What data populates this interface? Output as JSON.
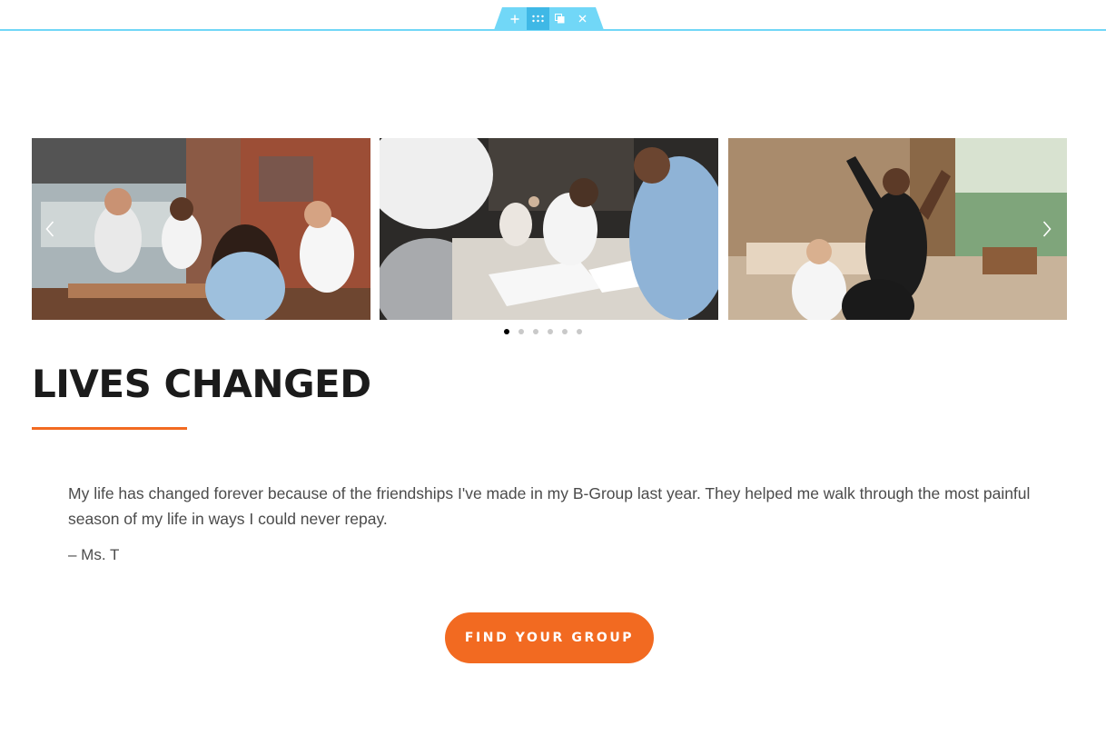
{
  "editor": {
    "handle_icons": [
      "plus-icon",
      "drag-grid-icon",
      "duplicate-icon",
      "close-icon"
    ],
    "accent_color": "#71d7f7"
  },
  "carousel": {
    "slides": [
      {
        "subject": "friends-cafe-photo"
      },
      {
        "subject": "bible-study-table-photo"
      },
      {
        "subject": "celebration-lobby-photo"
      }
    ],
    "prev_icon": "chevron-left-icon",
    "next_icon": "chevron-right-icon",
    "dot_count": 6,
    "active_dot": 0
  },
  "section": {
    "heading": "LIVES CHANGED",
    "accent_color": "#f26a21"
  },
  "testimonial": {
    "quote": "My life has changed forever because of the friendships I've made in my B-Group last year. They helped me walk through the most painful season of my life in ways I could never repay.",
    "attribution": "– Ms. T"
  },
  "cta": {
    "label": "FIND YOUR GROUP",
    "color": "#f26a21"
  }
}
